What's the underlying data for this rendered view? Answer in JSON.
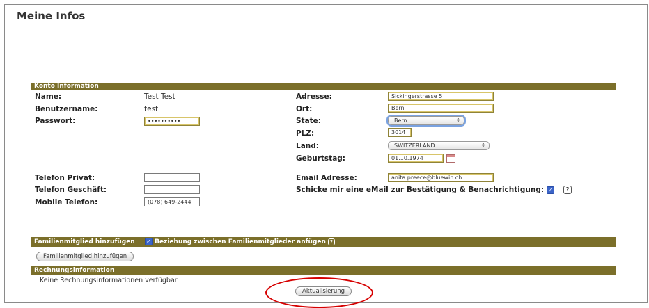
{
  "page": {
    "title": "Meine Infos"
  },
  "konto": {
    "header": "Konto Information",
    "name_label": "Name:",
    "name_value": "Test Test",
    "username_label": "Benutzername:",
    "username_value": "test",
    "password_label": "Passwort:",
    "password_value": "••••••••••",
    "address_label": "Adresse:",
    "address_value": "Sickingerstrasse 5",
    "city_label": "Ort:",
    "city_value": "Bern",
    "state_label": "State:",
    "state_value": "Bern",
    "plz_label": "PLZ:",
    "plz_value": "3014",
    "country_label": "Land:",
    "country_value": "SWITZERLAND",
    "birthday_label": "Geburtstag:",
    "birthday_value": "01.10.1974",
    "phone_private_label": "Telefon Privat:",
    "phone_private_value": "",
    "phone_business_label": "Telefon Geschäft:",
    "phone_business_value": "",
    "mobile_label": "Mobile Telefon:",
    "mobile_value": "(078) 649-2444",
    "email_label": "Email Adresse:",
    "email_value": "anita.preece@bluewin.ch",
    "notify_label": "Schicke mir eine eMail zur Bestätigung & Benachrichtigung:",
    "notify_checked": true,
    "help_glyph": "?"
  },
  "family": {
    "header": "Familienmitglied hinzufügen",
    "relation_label": "Beziehung zwischen Familienmitglieder anfügen",
    "relation_checked": true,
    "add_button": "Familienmitglied hinzufügen"
  },
  "billing": {
    "header": "Rechnungsinformation",
    "empty_text": "Keine Rechnungsinformationen verfügbar"
  },
  "actions": {
    "update_button": "Aktualisierung"
  },
  "icons": {
    "checkmark": "✓",
    "select_arrows": "↕"
  },
  "colors": {
    "bar": "#7b6f2a",
    "highlight": "#d60000",
    "checkbox": "#3b64c8"
  }
}
